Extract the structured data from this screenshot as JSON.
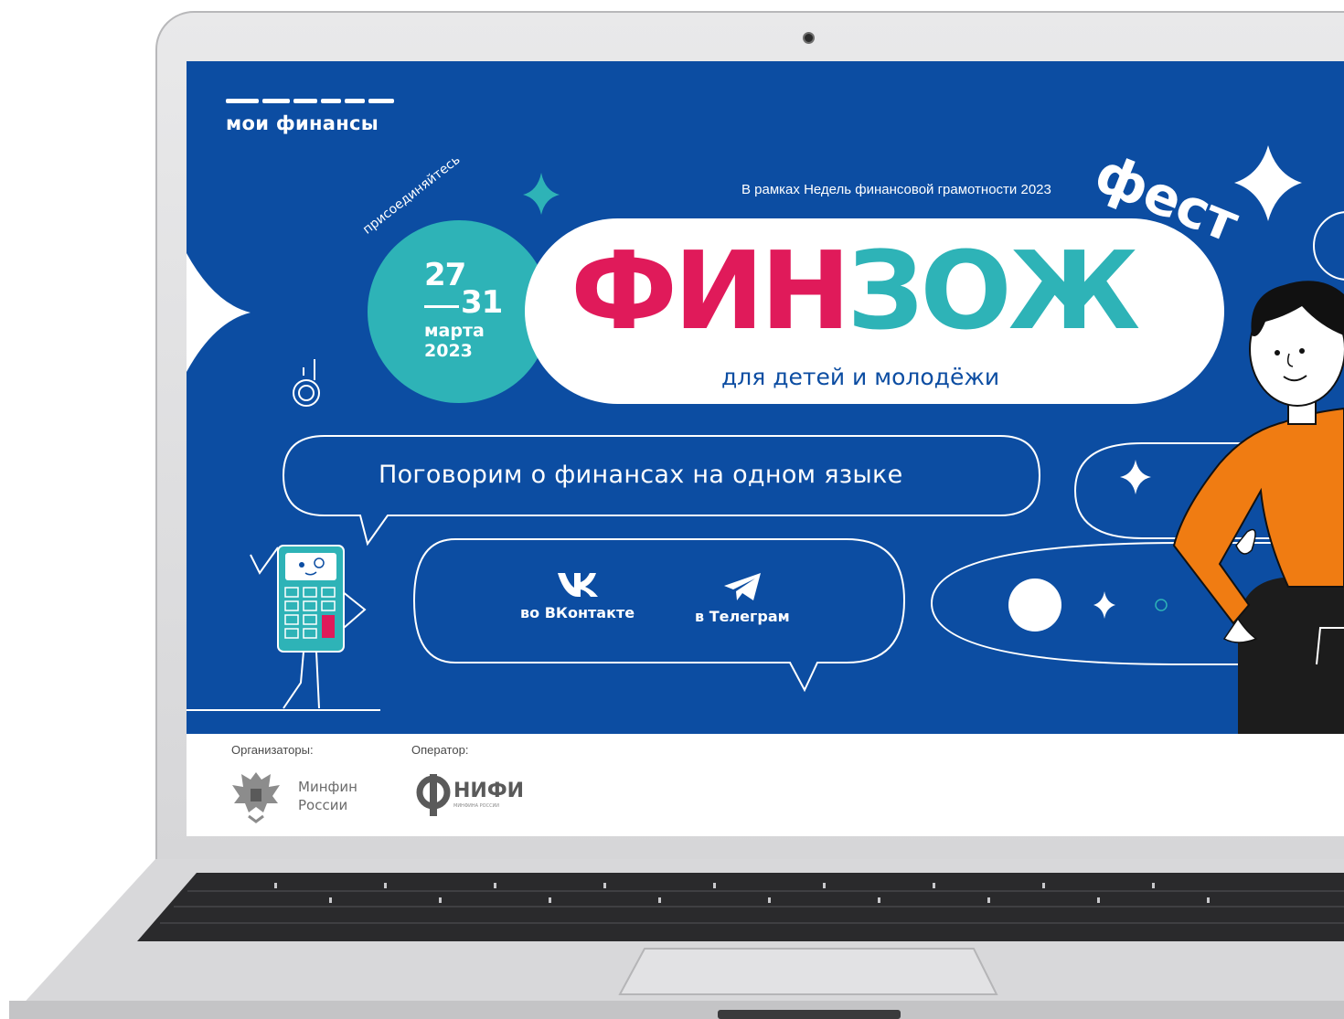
{
  "site": {
    "logo_text": "мои финансы",
    "context_text": "В рамках Недель финансовой грамотности 2023",
    "fest_word": "фест",
    "join_word": "присоединяйтесь",
    "date": {
      "start_day": "27",
      "end_day": "31",
      "month": "марта",
      "year": "2023"
    },
    "title": {
      "red_part": "ФИН",
      "teal_part": "ЗОЖ",
      "subtitle": "для детей и молодёжи"
    },
    "slogan": "Поговорим о финансах на одном языке",
    "social": [
      {
        "label": "во ВКонтакте",
        "icon": "vk-icon"
      },
      {
        "label": "в Телеграм",
        "icon": "telegram-icon"
      }
    ],
    "hashtag_glyph": "#"
  },
  "footer": {
    "organizers_label": "Организаторы:",
    "organizer_name": "Минфин России",
    "operator_label": "Оператор:",
    "operator_name": "НИФИ",
    "operator_sub": "МИНФИНА РОССИИ"
  },
  "colors": {
    "banner_blue": "#0c4da2",
    "accent_red": "#e01a5a",
    "accent_teal": "#2eb3b7",
    "character_orange": "#f07c12"
  }
}
